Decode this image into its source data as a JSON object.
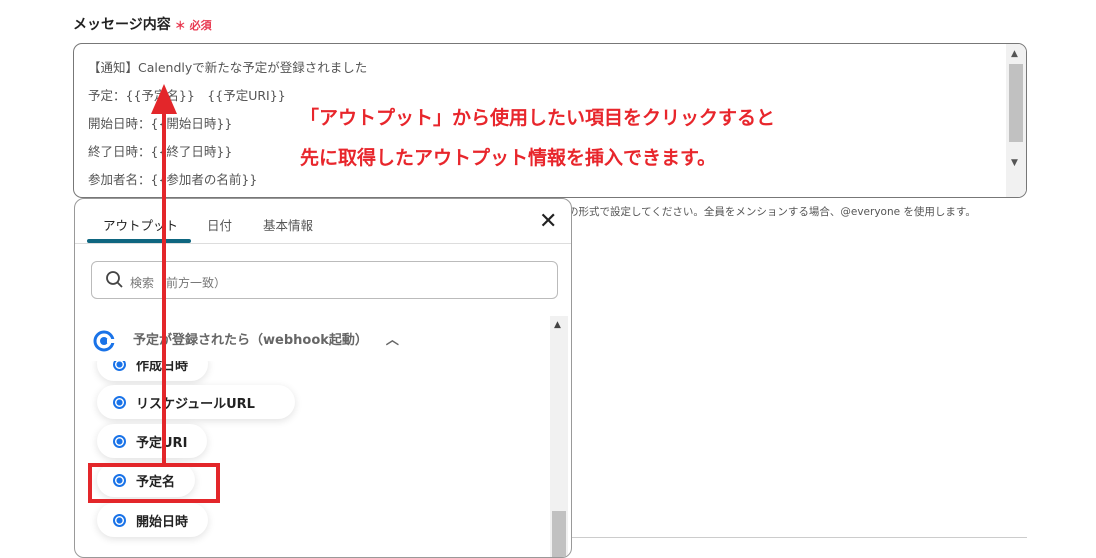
{
  "field": {
    "label": "メッセージ内容",
    "required_mark": "＊",
    "required_text": "必須"
  },
  "textarea": {
    "lines": [
      "【通知】Calendlyで新たな予定が登録されました",
      "予定：{{予定名}}　{{予定URI}}",
      "開始日時：{{開始日時}}",
      "終了日時：{{終了日時}}",
      "参加者名：{{参加者の名前}}"
    ]
  },
  "hint": "の形式で設定してください。全員をメンションする場合、@everyone を使用します。",
  "popup": {
    "tabs": [
      "アウトプット",
      "日付",
      "基本情報"
    ],
    "search_placeholder": "検索（前方一致）",
    "section": "予定が登録されたら（webhook起動）",
    "items": [
      "作成日時",
      "リスケジュールURL",
      "予定URI",
      "予定名",
      "開始日時"
    ]
  },
  "annotation": {
    "line1": "「アウトプット」から使用したい項目をクリックすると",
    "line2": "先に取得したアウトプット情報を挿入できます。"
  },
  "colors": {
    "accent": "#e3262a",
    "tab": "#0e6680",
    "brand": "#1a73e8"
  }
}
